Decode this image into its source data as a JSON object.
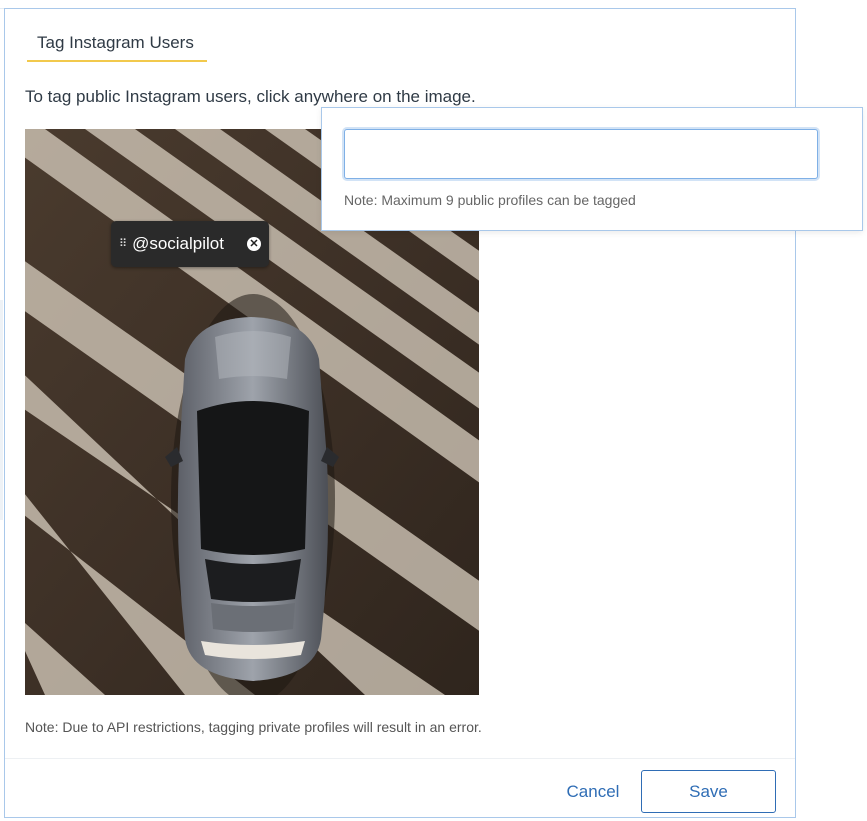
{
  "modal": {
    "tab_title": "Tag Instagram Users",
    "instructions": "To tag public Instagram users, click anywhere on the image.",
    "footer_note": "Note: Due to API restrictions, tagging private profiles will result in an error.",
    "cancel_label": "Cancel",
    "save_label": "Save"
  },
  "tag": {
    "username": "@socialpilot",
    "grip_icon": "drag-handle-icon",
    "close_icon": "close-icon",
    "close_glyph": "✕"
  },
  "popover": {
    "input_value": "",
    "input_placeholder": "",
    "note": "Note: Maximum 9 public profiles can be tagged"
  },
  "colors": {
    "accent_blue": "#2f6db5",
    "tab_underline": "#f2c94c",
    "border_blue": "#a9c8ea",
    "chip_bg": "#2a2a2a"
  }
}
